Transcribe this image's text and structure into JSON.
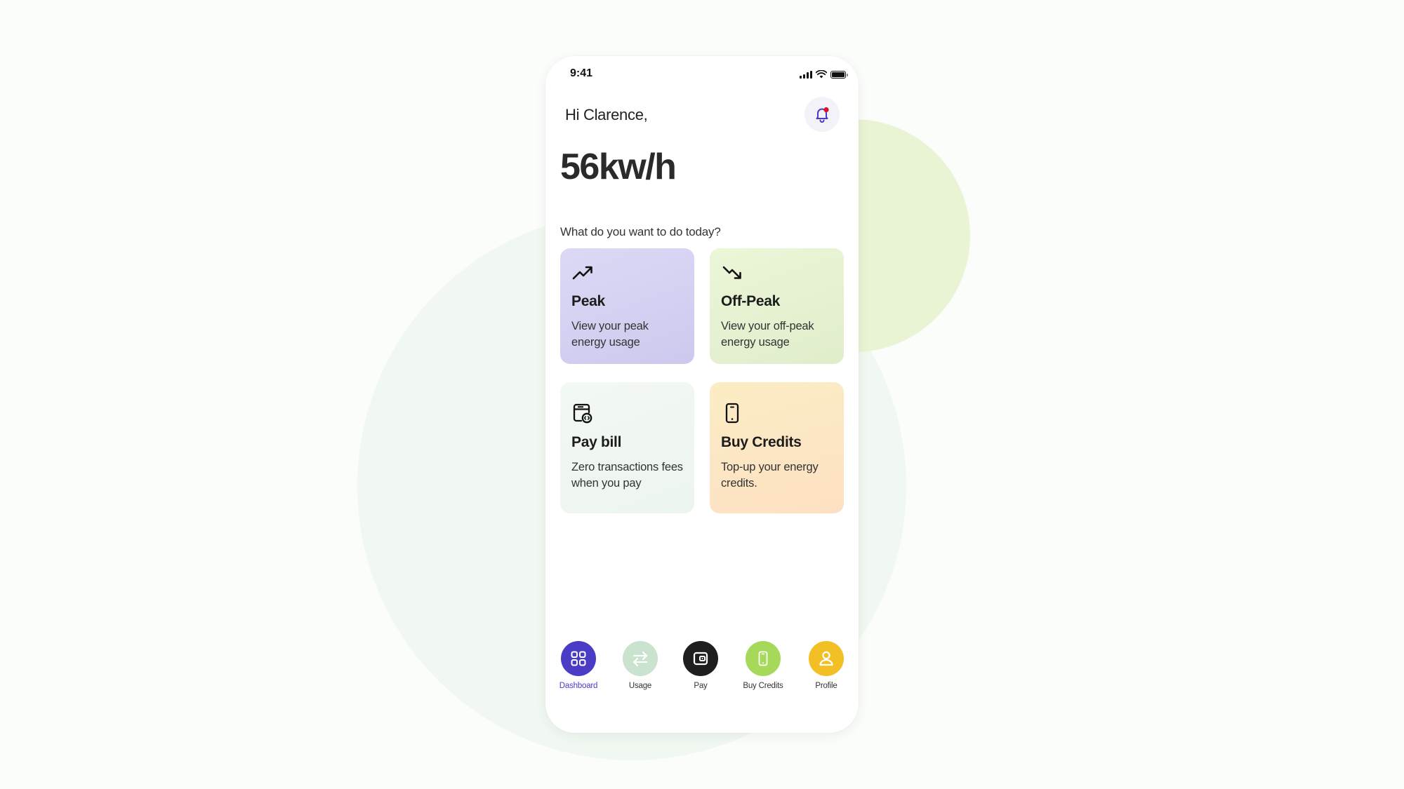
{
  "status_bar": {
    "time": "9:41",
    "icons": [
      "cellular-signal-icon",
      "wifi-icon",
      "battery-icon"
    ]
  },
  "header": {
    "greeting": "Hi Clarence,",
    "notification_icon": "bell-icon",
    "has_unread_notification": true
  },
  "summary": {
    "usage_value": "56kw/h"
  },
  "actions": {
    "prompt": "What do you want to do today?",
    "cards": [
      {
        "id": "peak",
        "icon": "trending-up-icon",
        "title": "Peak",
        "description": "View your peak energy usage"
      },
      {
        "id": "offpeak",
        "icon": "trending-down-icon",
        "title": "Off-Peak",
        "description": "View your off-peak energy usage"
      },
      {
        "id": "paybill",
        "icon": "bill-payment-icon",
        "title": "Pay bill",
        "description": "Zero transactions fees when you pay"
      },
      {
        "id": "buycredits",
        "icon": "mobile-phone-icon",
        "title": "Buy Credits",
        "description": "Top-up your energy credits."
      }
    ]
  },
  "bottom_nav": {
    "active": "Dashboard",
    "items": [
      {
        "label": "Dashboard",
        "icon": "grid-icon",
        "color": "#4b3cc6"
      },
      {
        "label": "Usage",
        "icon": "swap-arrows-icon",
        "color": "#c9e3cf"
      },
      {
        "label": "Pay",
        "icon": "wallet-icon",
        "color": "#1e1e1e"
      },
      {
        "label": "Buy Credits",
        "icon": "mobile-phone-icon",
        "color": "#a6d95a"
      },
      {
        "label": "Profile",
        "icon": "user-icon",
        "color": "#f2c025"
      }
    ]
  },
  "colors": {
    "accent": "#4b3cc6",
    "notification_dot": "#e0102a",
    "peak_card": "#d5d2f3",
    "offpeak_card": "#e6f2d2",
    "paybill_card": "#eff7f0",
    "buycredits_card": "#fde6c3"
  }
}
